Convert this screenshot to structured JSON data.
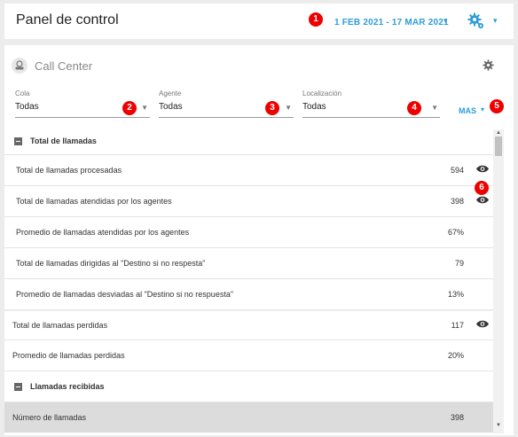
{
  "header": {
    "title": "Panel de control",
    "date_range": "1 FEB 2021 - 17 MAR 2021",
    "caret": "▾"
  },
  "widget": {
    "title": "Call Center"
  },
  "filters": [
    {
      "label": "Cola",
      "value": "Todas"
    },
    {
      "label": "Agente",
      "value": "Todas"
    },
    {
      "label": "Localización",
      "value": "Todas"
    }
  ],
  "more_label": "MAS",
  "sections": {
    "total_llamadas": "Total de llamadas",
    "llamadas_recibidas": "Llamadas recibidas"
  },
  "rows": [
    {
      "label": "Total de llamadas procesadas",
      "value": "594"
    },
    {
      "label": "Total de llamadas atendidas por los agentes",
      "value": "398"
    },
    {
      "label": "Promedio de llamadas atendidas por los agentes",
      "value": "67%"
    },
    {
      "label": "Total de llamadas dirigidas al \"Destino si no respesta\"",
      "value": "79"
    },
    {
      "label": "Promedio de llamadas desviadas al \"Destino si no respuesta\"",
      "value": "13%"
    },
    {
      "label": "Total de llamadas perdidas",
      "value": "117"
    },
    {
      "label": "Promedio de llamadas perdidas",
      "value": "20%"
    },
    {
      "label": "Número de llamadas",
      "value": "398"
    }
  ],
  "badges": [
    "1",
    "2",
    "3",
    "4",
    "5",
    "6"
  ],
  "colors": {
    "accent": "#2d9cdb",
    "badge": "#e00000"
  }
}
